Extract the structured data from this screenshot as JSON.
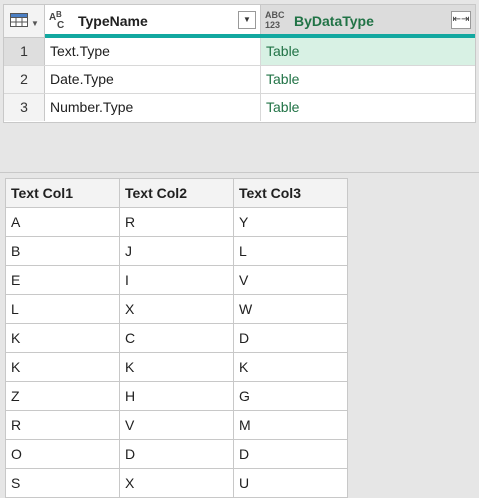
{
  "query_grid": {
    "columns": [
      {
        "type_icon_top": "A",
        "type_icon_bottom": "B",
        "type_icon_sub": "C",
        "name": "TypeName"
      },
      {
        "type_icon_top": "ABC",
        "type_icon_bottom": "123",
        "name": "ByDataType"
      }
    ],
    "rows": [
      {
        "num": "1",
        "type_name": "Text.Type",
        "by_data_type": "Table"
      },
      {
        "num": "2",
        "type_name": "Date.Type",
        "by_data_type": "Table"
      },
      {
        "num": "3",
        "type_name": "Number.Type",
        "by_data_type": "Table"
      }
    ]
  },
  "preview_table": {
    "headers": [
      "Text Col1",
      "Text Col2",
      "Text Col3"
    ],
    "rows": [
      [
        "A",
        "R",
        "Y"
      ],
      [
        "B",
        "J",
        "L"
      ],
      [
        "E",
        "I",
        "V"
      ],
      [
        "L",
        "X",
        "W"
      ],
      [
        "K",
        "C",
        "D"
      ],
      [
        "K",
        "K",
        "K"
      ],
      [
        "Z",
        "H",
        "G"
      ],
      [
        "R",
        "V",
        "M"
      ],
      [
        "O",
        "D",
        "D"
      ],
      [
        "S",
        "X",
        "U"
      ]
    ]
  },
  "colors": {
    "accent_teal": "#12a8a0",
    "selected_cell": "#d8f1e4",
    "green_text": "#217346"
  },
  "icons": [
    "table-menu-icon",
    "text-type-icon",
    "any-type-icon",
    "filter-dropdown-icon",
    "expand-column-icon"
  ]
}
